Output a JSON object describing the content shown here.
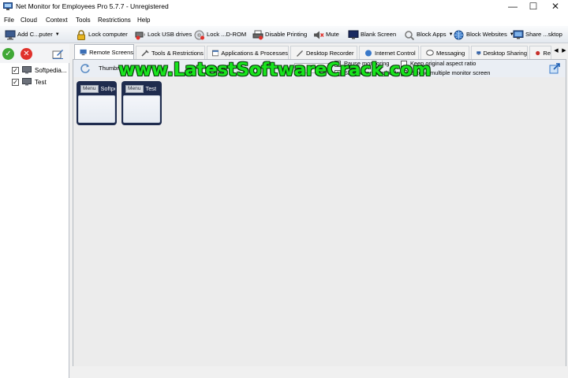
{
  "window": {
    "title": "Net Monitor for Employees Pro 5.7.7 - Unregistered",
    "controls": {
      "minimize": "—",
      "maximize": "☐",
      "close": "✕"
    }
  },
  "menu": [
    "File",
    "Cloud",
    "Context",
    "Tools",
    "Restrictions",
    "Help"
  ],
  "toolbar": [
    {
      "label": "Add C...puter",
      "icon": "add-computer-icon",
      "has_dropdown": true
    },
    {
      "label": "Lock computer",
      "icon": "lock-icon"
    },
    {
      "label": "Lock USB drives",
      "icon": "usb-lock-icon"
    },
    {
      "label": "Lock ...D-ROM",
      "icon": "cdrom-lock-icon"
    },
    {
      "label": "Disable Printing",
      "icon": "printer-icon"
    },
    {
      "label": "Mute",
      "icon": "mute-icon"
    },
    {
      "label": "Blank Screen",
      "icon": "monitor-icon"
    },
    {
      "label": "Block Apps",
      "icon": "block-apps-icon",
      "has_dropdown": true
    },
    {
      "label": "Block Websites",
      "icon": "globe-icon",
      "has_dropdown": true
    },
    {
      "label": "Share ...sktop",
      "icon": "share-desktop-icon"
    }
  ],
  "sidebar": {
    "tools": [
      "confirm-icon",
      "cancel-icon",
      "edit-icon"
    ],
    "computers": [
      {
        "label": "Softpedia...",
        "checked": true
      },
      {
        "label": "Test",
        "checked": true
      }
    ]
  },
  "tabs": [
    {
      "label": "Remote Screens",
      "active": true,
      "icon": "remote-screens-icon"
    },
    {
      "label": "Tools & Restrictions",
      "icon": "tools-icon"
    },
    {
      "label": "Applications & Processes",
      "icon": "apps-icon"
    },
    {
      "label": "Desktop Recorder",
      "icon": "recorder-icon"
    },
    {
      "label": "Internet Control",
      "icon": "internet-icon"
    },
    {
      "label": "Messaging",
      "icon": "message-icon"
    },
    {
      "label": "Desktop Sharing",
      "icon": "sharing-icon"
    },
    {
      "label": "Re",
      "icon": "record-icon"
    }
  ],
  "tab_nav": {
    "prev": "◀",
    "next": "▶"
  },
  "options": {
    "thumbnails_label": "Thumbna",
    "checkboxes": [
      {
        "label": "Pause monitoring",
        "checked": false
      },
      {
        "label": "Show connected only",
        "checked": false
      },
      {
        "label": "Keep original aspect ratio",
        "checked": false
      },
      {
        "label": "Extend multiple monitor screen",
        "checked": false
      }
    ]
  },
  "screens": [
    {
      "menu_label": "Menu",
      "name": "Softpe"
    },
    {
      "menu_label": "Menu",
      "name": "Test"
    }
  ],
  "watermark": "www.LatestSoftwareCrack.com",
  "colors": {
    "accent": "#1f2c4e",
    "watermark": "#18e41d",
    "ok_green": "#40a836",
    "cancel_red": "#e0312b"
  }
}
